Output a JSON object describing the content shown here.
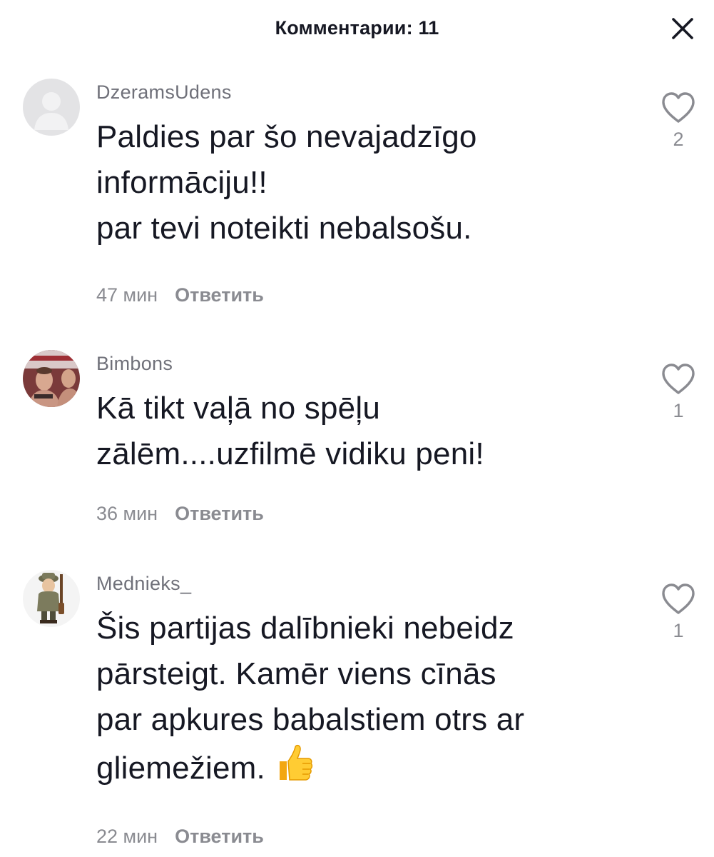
{
  "header": {
    "title": "Комментарии: 11"
  },
  "comments": [
    {
      "username": "DzeramsUdens",
      "text": "Paldies par šo nevajadzīgo\ninformāciju!!\npar tevi noteikti nebalsošu.",
      "time": "47 мин",
      "reply_label": "Ответить",
      "likes": "2",
      "avatar": "default-avatar-icon"
    },
    {
      "username": "Bimbons",
      "text": "Kā tikt vaļā no spēļu\nzālēm....uzfilmē vidiku peni!",
      "time": "36 мин",
      "reply_label": "Ответить",
      "likes": "1",
      "avatar": "photo-avatar"
    },
    {
      "username": "Mednieks_",
      "text": "Šis partijas dalībnieki nebeidz\npārsteigt. Kamēr viens cīnās\npar apkures babalstiem otrs ar\ngliemežiem.",
      "emoji": "👍",
      "time": "22 мин",
      "reply_label": "Ответить",
      "likes": "1",
      "avatar": "hunter-avatar"
    }
  ],
  "icons": {
    "close": "close-icon",
    "like": "heart-outline-icon"
  },
  "colors": {
    "text": "#161823",
    "secondary": "#8a8b91",
    "username": "#6f7079"
  }
}
